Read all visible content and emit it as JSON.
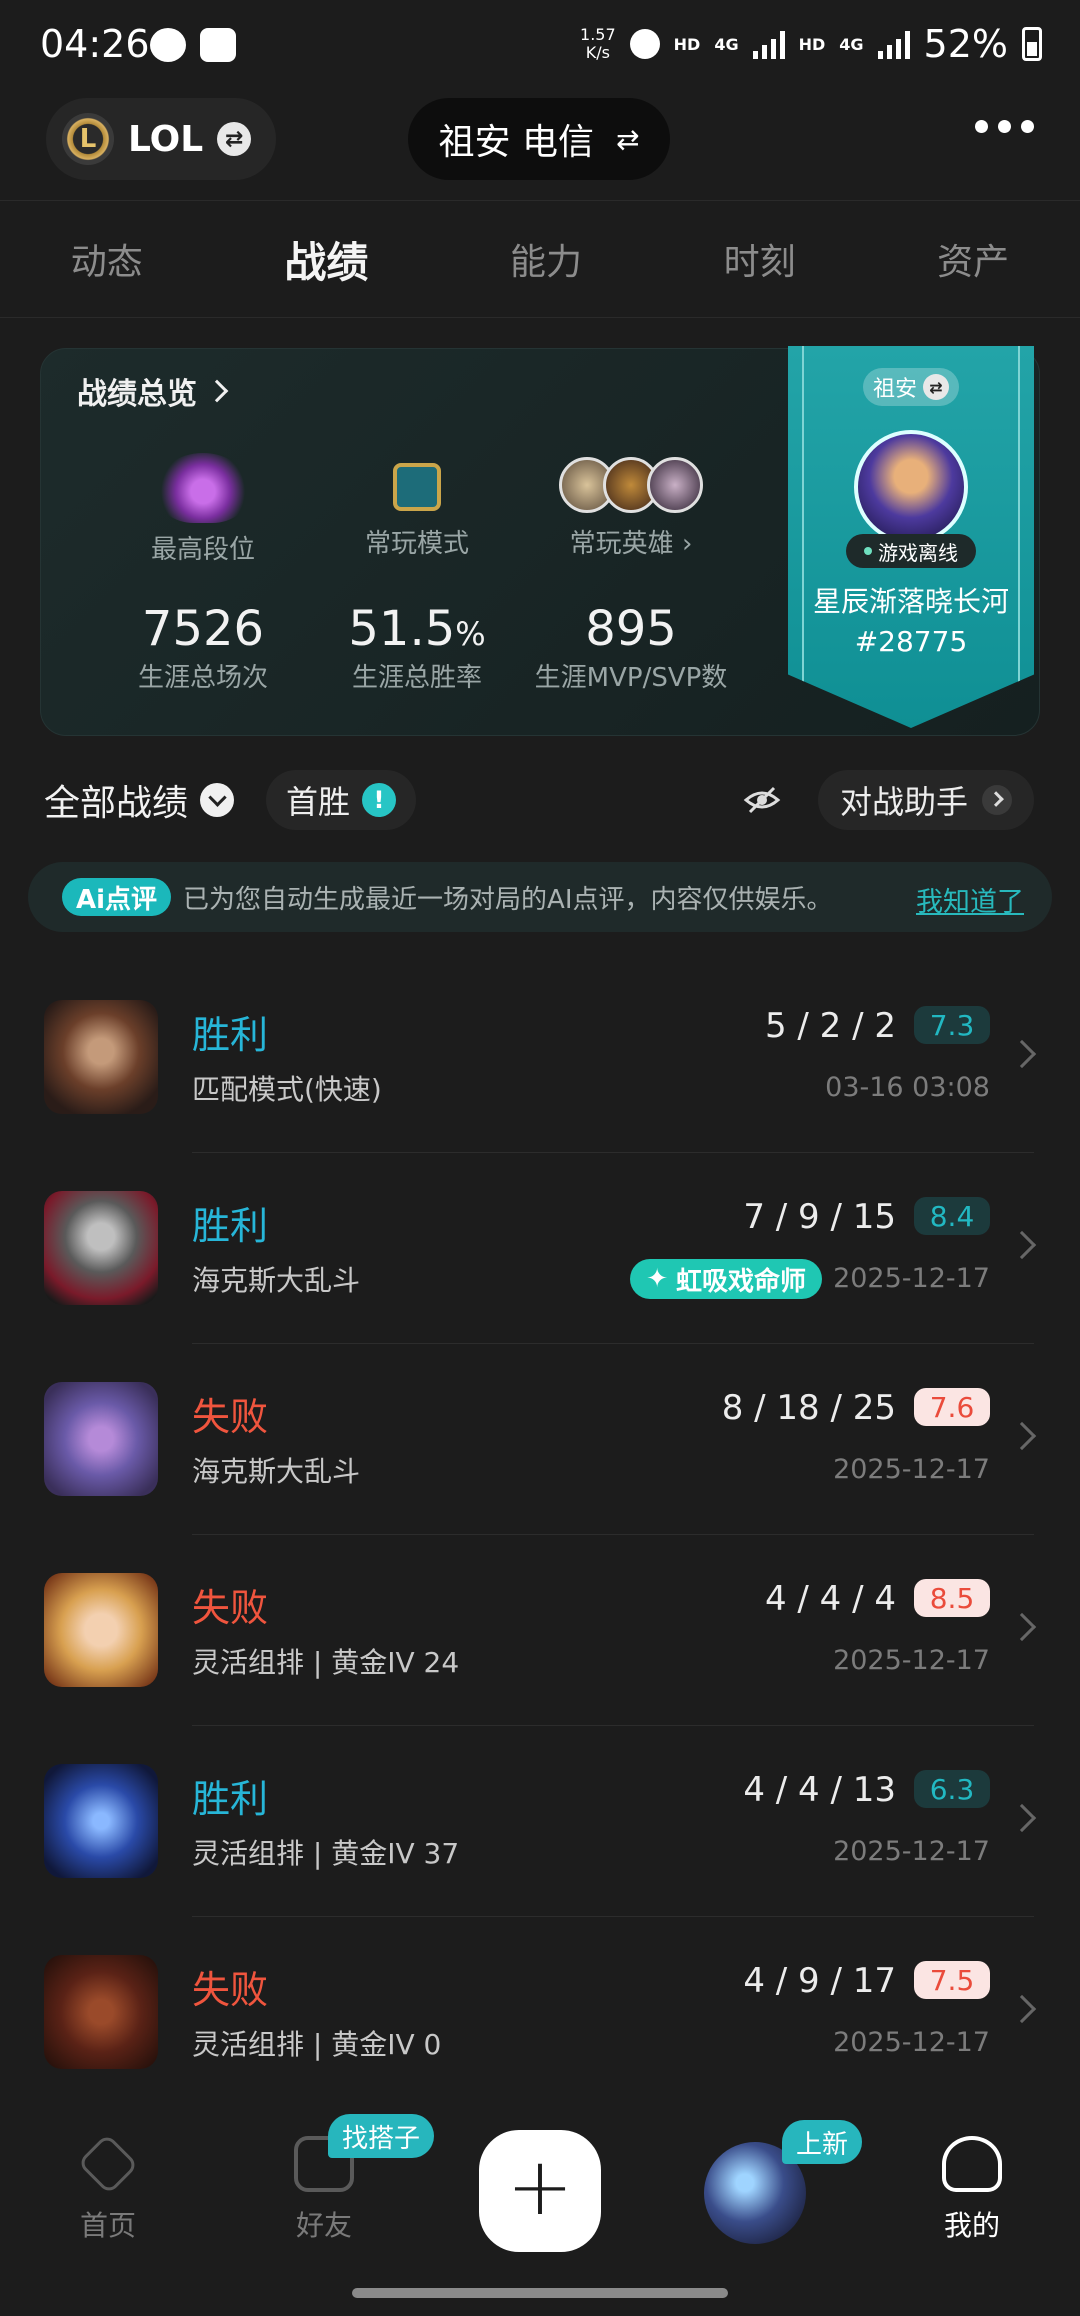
{
  "status_bar": {
    "time": "04:26",
    "speed_value": "1.57",
    "speed_unit": "K/s",
    "hd1": "HD",
    "net1": "4G",
    "hd2": "HD",
    "net2": "4G",
    "battery": "52%"
  },
  "header": {
    "game_name": "LOL",
    "server": "祖安 电信"
  },
  "tabs": [
    "动态",
    "战绩",
    "能力",
    "时刻",
    "资产"
  ],
  "active_tab": "战绩",
  "overview": {
    "title": "战绩总览",
    "highest_rank_label": "最高段位",
    "common_mode_label": "常玩模式",
    "common_heroes_label": "常玩英雄",
    "total_games": "7526",
    "total_games_label": "生涯总场次",
    "win_rate_value": "51.5",
    "win_rate_unit": "%",
    "win_rate_label": "生涯总胜率",
    "mvp_count": "895",
    "mvp_label": "生涯MVP/SVP数"
  },
  "profile": {
    "region": "祖安",
    "status": "游戏离线",
    "name": "星辰渐落晓长河",
    "tag": "#28775"
  },
  "filters": {
    "all_records": "全部战绩",
    "first_win": "首胜",
    "first_win_badge": "!",
    "assistant": "对战助手"
  },
  "ai_banner": {
    "tag": "Ai点评",
    "text": "已为您自动生成最近一场对局的AI点评，内容仅供娱乐。",
    "dismiss": "我知道了"
  },
  "matches": [
    {
      "result": "胜利",
      "mode": "匹配模式(快速)",
      "kda": "5 / 2 / 2",
      "score": "7.3",
      "date": "03-16 03:08",
      "outcome": "win"
    },
    {
      "result": "胜利",
      "mode": "海克斯大乱斗",
      "kda": "7 / 9 / 15",
      "score": "8.4",
      "date": "2025-12-17",
      "outcome": "win",
      "badge": "虹吸戏命师"
    },
    {
      "result": "失败",
      "mode": "海克斯大乱斗",
      "kda": "8 / 18 / 25",
      "score": "7.6",
      "date": "2025-12-17",
      "outcome": "lose"
    },
    {
      "result": "失败",
      "mode": "灵活组排 | 黄金IV 24",
      "kda": "4 / 4 / 4",
      "score": "8.5",
      "date": "2025-12-17",
      "outcome": "lose"
    },
    {
      "result": "胜利",
      "mode": "灵活组排 | 黄金IV 37",
      "kda": "4 / 4 / 13",
      "score": "6.3",
      "date": "2025-12-17",
      "outcome": "win"
    },
    {
      "result": "失败",
      "mode": "灵活组排 | 黄金IV 0",
      "kda": "4 / 9 / 17",
      "score": "7.5",
      "date": "2025-12-17",
      "outcome": "lose"
    }
  ],
  "bottom_nav": {
    "home": "首页",
    "friends": "好友",
    "friends_badge": "找搭子",
    "promo_badge": "上新",
    "me": "我的"
  },
  "colors": {
    "win": "#27b6d8",
    "lose": "#f0553e",
    "accent": "#1bb8bb",
    "background": "#1c1c1c"
  },
  "icons": [
    "message-icon",
    "image-icon",
    "alarm-icon",
    "signal-icon",
    "battery-icon",
    "swap-icon",
    "more-icon",
    "eye-hidden-icon",
    "chevron-right-icon",
    "plus-icon",
    "home-icon",
    "chat-icon",
    "profile-icon"
  ]
}
